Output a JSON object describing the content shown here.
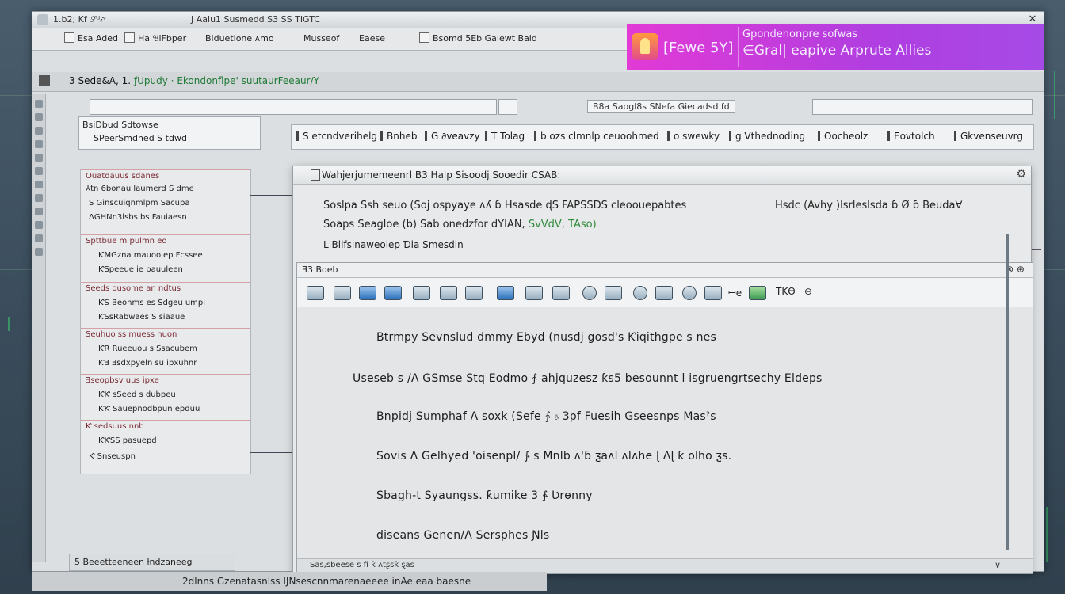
{
  "window": {
    "title_left": "1.b2; Kf 𝒮ᵈ𝒾ᵛ",
    "title_center": "J Aaiu1 Susmedd S3 SS TIGTC"
  },
  "toolbar": {
    "items": [
      "Esa Aded",
      "Ha 𝔅iFbper",
      "Biduetione ᴀmo",
      "Musseof",
      "Eaese",
      "Bsomd 5Eb Galewt Baid"
    ]
  },
  "banner": {
    "name": "[Fewe 5Y]",
    "line1": "Ǥpondenonpre sofwas",
    "line2": "∈Gral| eapive Arprute Allies"
  },
  "pathbar": {
    "prefix": "3 Sede&A, 1. ",
    "path": "ƒUpudy ⋅ Ekondonflpe' suutaurFeeaur/Y"
  },
  "search": {
    "right_label": "B8a Saogl8s SNefa Ǥiecadsd fd"
  },
  "panel_left": {
    "header": "BsiDbud  Sdtowse",
    "value": "SPeerSmdhed  S tdwd"
  },
  "tabs": [
    "S etcndverihelg",
    "Bnheb",
    "G ∂veavzy",
    "T Tolag",
    "b ozs clmnlp ceuoohmed",
    "o swewky",
    "g Vthednoding",
    "Oocheolz",
    "Eovtolch",
    "Gkvenseuvrg"
  ],
  "sidelist": {
    "groups": [
      {
        "header": "Ouatdauus  sdanes",
        "lines": [
          "⅄tn 6bonau laumerd S dme",
          "S Ginscuiqnmlpm Sacupa",
          "ɅGHNn3lsbs bs Fauiaesn"
        ]
      },
      {
        "header": "Spttbue  m pulmn  ed",
        "lines": [
          "ƘMGzna mauoolep Fcssee",
          "ƘSpeeue  ie pauuleen"
        ]
      },
      {
        "header": "Seeds  ousome an ndtus",
        "lines": [
          "ƘS Beonms es Sdgeu umpi",
          "ƘSsRabwaes S siaaue"
        ]
      },
      {
        "header": "Seuhuo ss muess nuon",
        "lines": [
          "ƘR Rueeuou s Ssacubem",
          "ƘƎ Ǝsdxpyeln su ipxuhnr"
        ]
      },
      {
        "header": "Ǝseopbsv  uus ipxe",
        "lines": [
          "ƘƘ sSeed s dubpeu",
          "ƘƘ Sauepnodbpun epduu"
        ]
      },
      {
        "header": "Ƙ sedsuus  nnb",
        "lines": [
          "ƘƘSS pasuepd",
          "Ƙ Snseuspn"
        ]
      }
    ]
  },
  "dialog": {
    "title": "Wahjerjumemeenrl B3 Halp Sisoodj Sooedir CSAB:",
    "line1": "Soslpa   Ssh seuo (Soj ospyaye ʌʎ ɓ Hsasde ɖS FAPSSDS cleoouepabtes",
    "line1_right": "Hsdc (Avhy )lsrleslsda ɓ Ø ɓ Beuda∀",
    "line2_a": "Soaps Seagloe (b) Sab onedzfor dYIAN,",
    "line2_b": "SvVdV, TAso)",
    "line3": "L    Bllfsinaweolep Ɗia Smesdin"
  },
  "inner": {
    "title": "Ǝ3  Boeb",
    "controls": "⊗ ⊕",
    "tool_tags": [
      "ꟷe",
      "TKϴ",
      "⊖"
    ],
    "rows": [
      "Btrmpy  Sevnslud  dmmy  Ebyd  (nusdj  gosd's  Ƙiqithgpe s  nes",
      "Useseb s /Λ  ǤSmse  Stq  Eodmo  ∱  ahjquzesz   ƙs5  besounnt  l isgruengrtsechy  Eldeps",
      "Bnpidj   Sumphaf  Λ  soxk  (Sefe  ∱ 𝔰 3pf  Fuesih  Gseesnps   Masˀs",
      "Sovis  Λ  Gelhyed  'oisenpl/  ∱ s   Mnlb  ʌ'ɓ   ƺaʌl  ʌlʌhe   ɭ  Ʌɭ  ƙ  olho  ƺs.",
      "Sbagh-t   Syaungss.   ƙumike   3 ∱   Ʋrɵnny",
      "diseans  Ǥenen/Λ  Sersphes  Ɲls"
    ],
    "status_left": "Sas,ѕbeese  s  fi  ƙ  ʌtʂsƙ  ȿas",
    "status_right": "∨"
  },
  "lower_tab": {
    "label": "5 Beeetteeneen  ƚndzaneeg"
  },
  "bottom_strip": {
    "label": "2dlnns  Gzenatasnlss   IJNsescnnmarenaeeee  inAe  eaa  baesne"
  }
}
